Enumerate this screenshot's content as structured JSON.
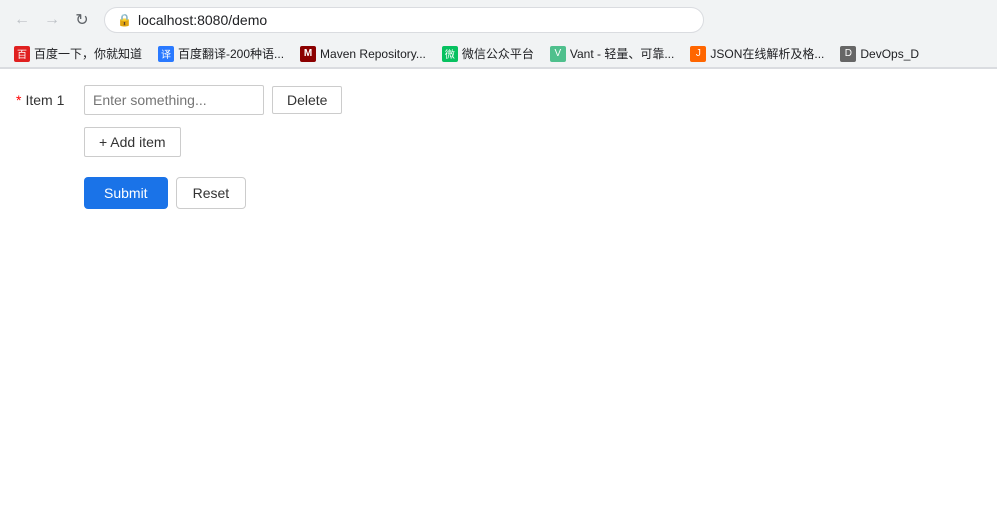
{
  "browser": {
    "url": "localhost:8080/demo",
    "back_disabled": true,
    "forward_disabled": true,
    "bookmarks": [
      {
        "label": "百度一下，你就知道",
        "favicon_color": "#e02020",
        "favicon_text": "百"
      },
      {
        "label": "百度翻译-200种语...",
        "favicon_color": "#2979ff",
        "favicon_text": "译"
      },
      {
        "label": "Maven Repository...",
        "favicon_color": "#8b0000",
        "favicon_text": "M"
      },
      {
        "label": "微信公众平台",
        "favicon_color": "#07c160",
        "favicon_text": "微"
      },
      {
        "label": "Vant - 轻量、可靠...",
        "favicon_color": "#4fc08d",
        "favicon_text": "V"
      },
      {
        "label": "JSON在线解析及格...",
        "favicon_color": "#ff6600",
        "favicon_text": "J"
      },
      {
        "label": "DevOps_D",
        "favicon_color": "#666",
        "favicon_text": "D"
      }
    ]
  },
  "form": {
    "item_label": "Item 1",
    "item_placeholder": "Enter something...",
    "required_star": "*",
    "add_item_label": "+ Add item",
    "delete_label": "Delete",
    "submit_label": "Submit",
    "reset_label": "Reset"
  },
  "icons": {
    "back": "←",
    "forward": "→",
    "refresh": "↻",
    "lock": "🔒",
    "plus": "+"
  }
}
